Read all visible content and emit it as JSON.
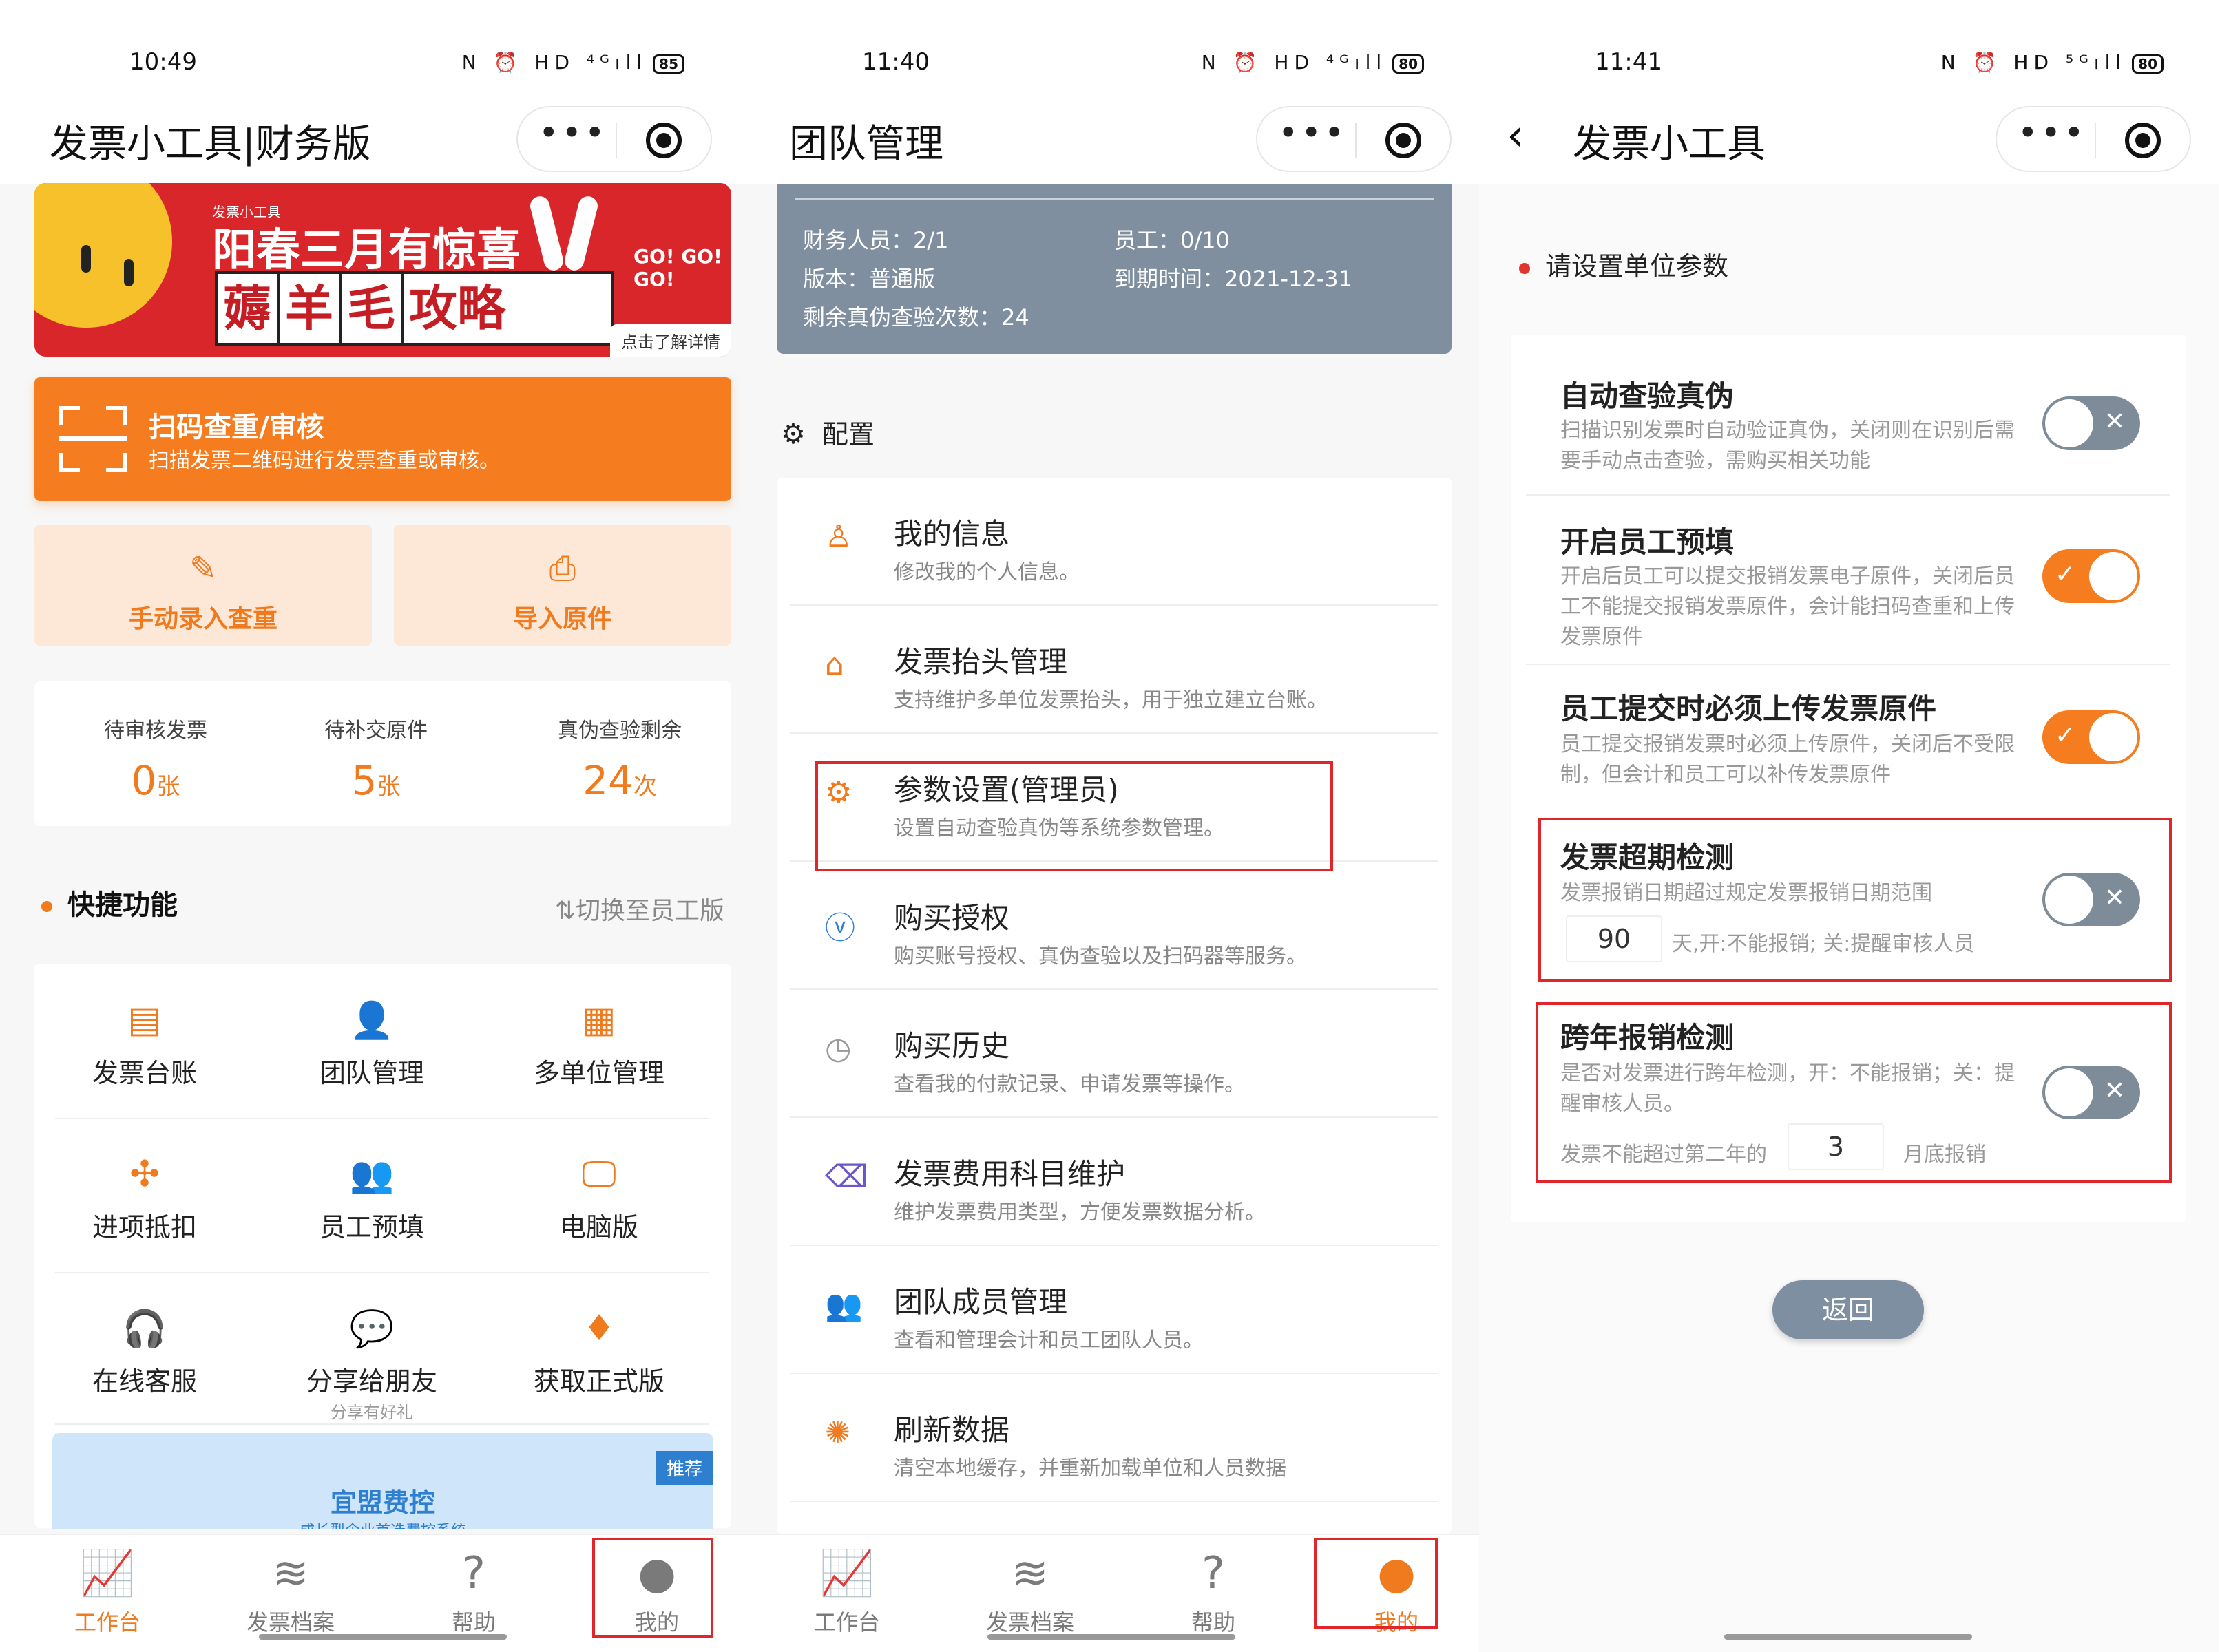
{
  "colors": {
    "accent": "#f57c1f",
    "red_highlight": "#e0262b",
    "gray_card": "#7f8fa0",
    "toggle_off": "#7e8b99"
  },
  "panel1": {
    "status": {
      "time": "10:49",
      "battery": "85",
      "icons": "N ⏰ HD ⁴ᴳıll"
    },
    "title": "发票小工具|财务版",
    "banner": {
      "small": "发票小工具",
      "headline": "阳春三月有惊喜",
      "chars": [
        "薅",
        "羊",
        "毛",
        "攻略"
      ],
      "go": "GO! GO! GO!",
      "tip": "点击了解详情"
    },
    "scan": {
      "title": "扫码查重/审核",
      "subtitle": "扫描发票二维码进行发票查重或审核。"
    },
    "actions": [
      {
        "label": "手动录入查重",
        "icon": "edit-icon"
      },
      {
        "label": "导入原件",
        "icon": "import-icon"
      }
    ],
    "stats": [
      {
        "label": "待审核发票",
        "value": "0",
        "unit": "张"
      },
      {
        "label": "待补交原件",
        "value": "5",
        "unit": "张"
      },
      {
        "label": "真伪查验剩余",
        "value": "24",
        "unit": "次"
      }
    ],
    "quick_title": "快捷功能",
    "switch_label": "⇅切换至员工版",
    "grid": [
      {
        "label": "发票台账",
        "icon": "ledger-icon",
        "glyph": "▤"
      },
      {
        "label": "团队管理",
        "icon": "team-icon",
        "glyph": "👤"
      },
      {
        "label": "多单位管理",
        "icon": "multi-unit-icon",
        "glyph": "▦"
      },
      {
        "label": "进项抵扣",
        "icon": "deduct-icon",
        "glyph": "✣"
      },
      {
        "label": "员工预填",
        "icon": "staff-icon",
        "glyph": "👥"
      },
      {
        "label": "电脑版",
        "icon": "monitor-icon",
        "glyph": "🖵"
      },
      {
        "label": "在线客服",
        "icon": "service-icon",
        "glyph": "🎧"
      },
      {
        "label": "分享给朋友",
        "sub": "分享有好礼",
        "icon": "share-icon",
        "glyph": "💬"
      },
      {
        "label": "获取正式版",
        "icon": "diamond-icon",
        "glyph": "♦"
      }
    ],
    "promo": {
      "title": "宜盟费控",
      "subtitle": "成长型企业首选费控系统",
      "badge": "推荐"
    },
    "tabs": [
      {
        "label": "工作台",
        "glyph": "📈"
      },
      {
        "label": "发票档案",
        "glyph": "≋"
      },
      {
        "label": "帮助",
        "glyph": "?"
      },
      {
        "label": "我的",
        "glyph": "●"
      }
    ]
  },
  "panel2": {
    "status": {
      "time": "11:40",
      "battery": "80",
      "icons": "N ⏰ HD ⁴ᴳıll"
    },
    "title": "团队管理",
    "info": {
      "finance": "财务人员：2/1",
      "staff": "员工：0/10",
      "version": "版本：普通版",
      "expire": "到期时间：2021-12-31",
      "remaining": "剩余真伪查验次数：24"
    },
    "config_title": "配置",
    "menu": [
      {
        "title": "我的信息",
        "desc": "修改我的个人信息。",
        "glyph": "♙"
      },
      {
        "title": "发票抬头管理",
        "desc": "支持维护多单位发票抬头，用于独立建立台账。",
        "glyph": "⌂"
      },
      {
        "title": "参数设置(管理员)",
        "desc": "设置自动查验真伪等系统参数管理。",
        "glyph": "⚙"
      },
      {
        "title": "购买授权",
        "desc": "购买账号授权、真伪查验以及扫码器等服务。",
        "glyph": "ⓥ"
      },
      {
        "title": "购买历史",
        "desc": "查看我的付款记录、申请发票等操作。",
        "glyph": "◷"
      },
      {
        "title": "发票费用科目维护",
        "desc": "维护发票费用类型，方便发票数据分析。",
        "glyph": "⌫"
      },
      {
        "title": "团队成员管理",
        "desc": "查看和管理会计和员工团队人员。",
        "glyph": "👥"
      },
      {
        "title": "刷新数据",
        "desc": "清空本地缓存，并重新加载单位和人员数据",
        "glyph": "✺"
      }
    ],
    "tabs": [
      {
        "label": "工作台",
        "glyph": "📈"
      },
      {
        "label": "发票档案",
        "glyph": "≋"
      },
      {
        "label": "帮助",
        "glyph": "?"
      },
      {
        "label": "我的",
        "glyph": "●"
      }
    ]
  },
  "panel3": {
    "status": {
      "time": "11:41",
      "battery": "80",
      "icons": "N ⏰ HD ⁵ᴳıll"
    },
    "title": "发票小工具",
    "header": "请设置单位参数",
    "settings": [
      {
        "title": "自动查验真伪",
        "desc": "扫描识别发票时自动验证真伪，关闭则在识别后需要手动点击查验，需购买相关功能",
        "state": "off"
      },
      {
        "title": "开启员工预填",
        "desc": "开启后员工可以提交报销发票电子原件，关闭后员工不能提交报销发票原件，会计能扫码查重和上传发票原件",
        "state": "on"
      },
      {
        "title": "员工提交时必须上传发票原件",
        "desc": "员工提交报销发票时必须上传原件，关闭后不受限制，但会计和员工可以补传发票原件",
        "state": "on"
      },
      {
        "title": "发票超期检测",
        "desc": "发票报销日期超过规定发票报销日期范围",
        "state": "off",
        "value": "90",
        "after": "天,开:不能报销; 关:提醒审核人员"
      },
      {
        "title": "跨年报销检测",
        "desc": "是否对发票进行跨年检测，开：不能报销；关：提醒审核人员。",
        "state": "off",
        "before": "发票不能超过第二年的",
        "value": "3",
        "after": "月底报销"
      }
    ],
    "back_label": "返回"
  }
}
